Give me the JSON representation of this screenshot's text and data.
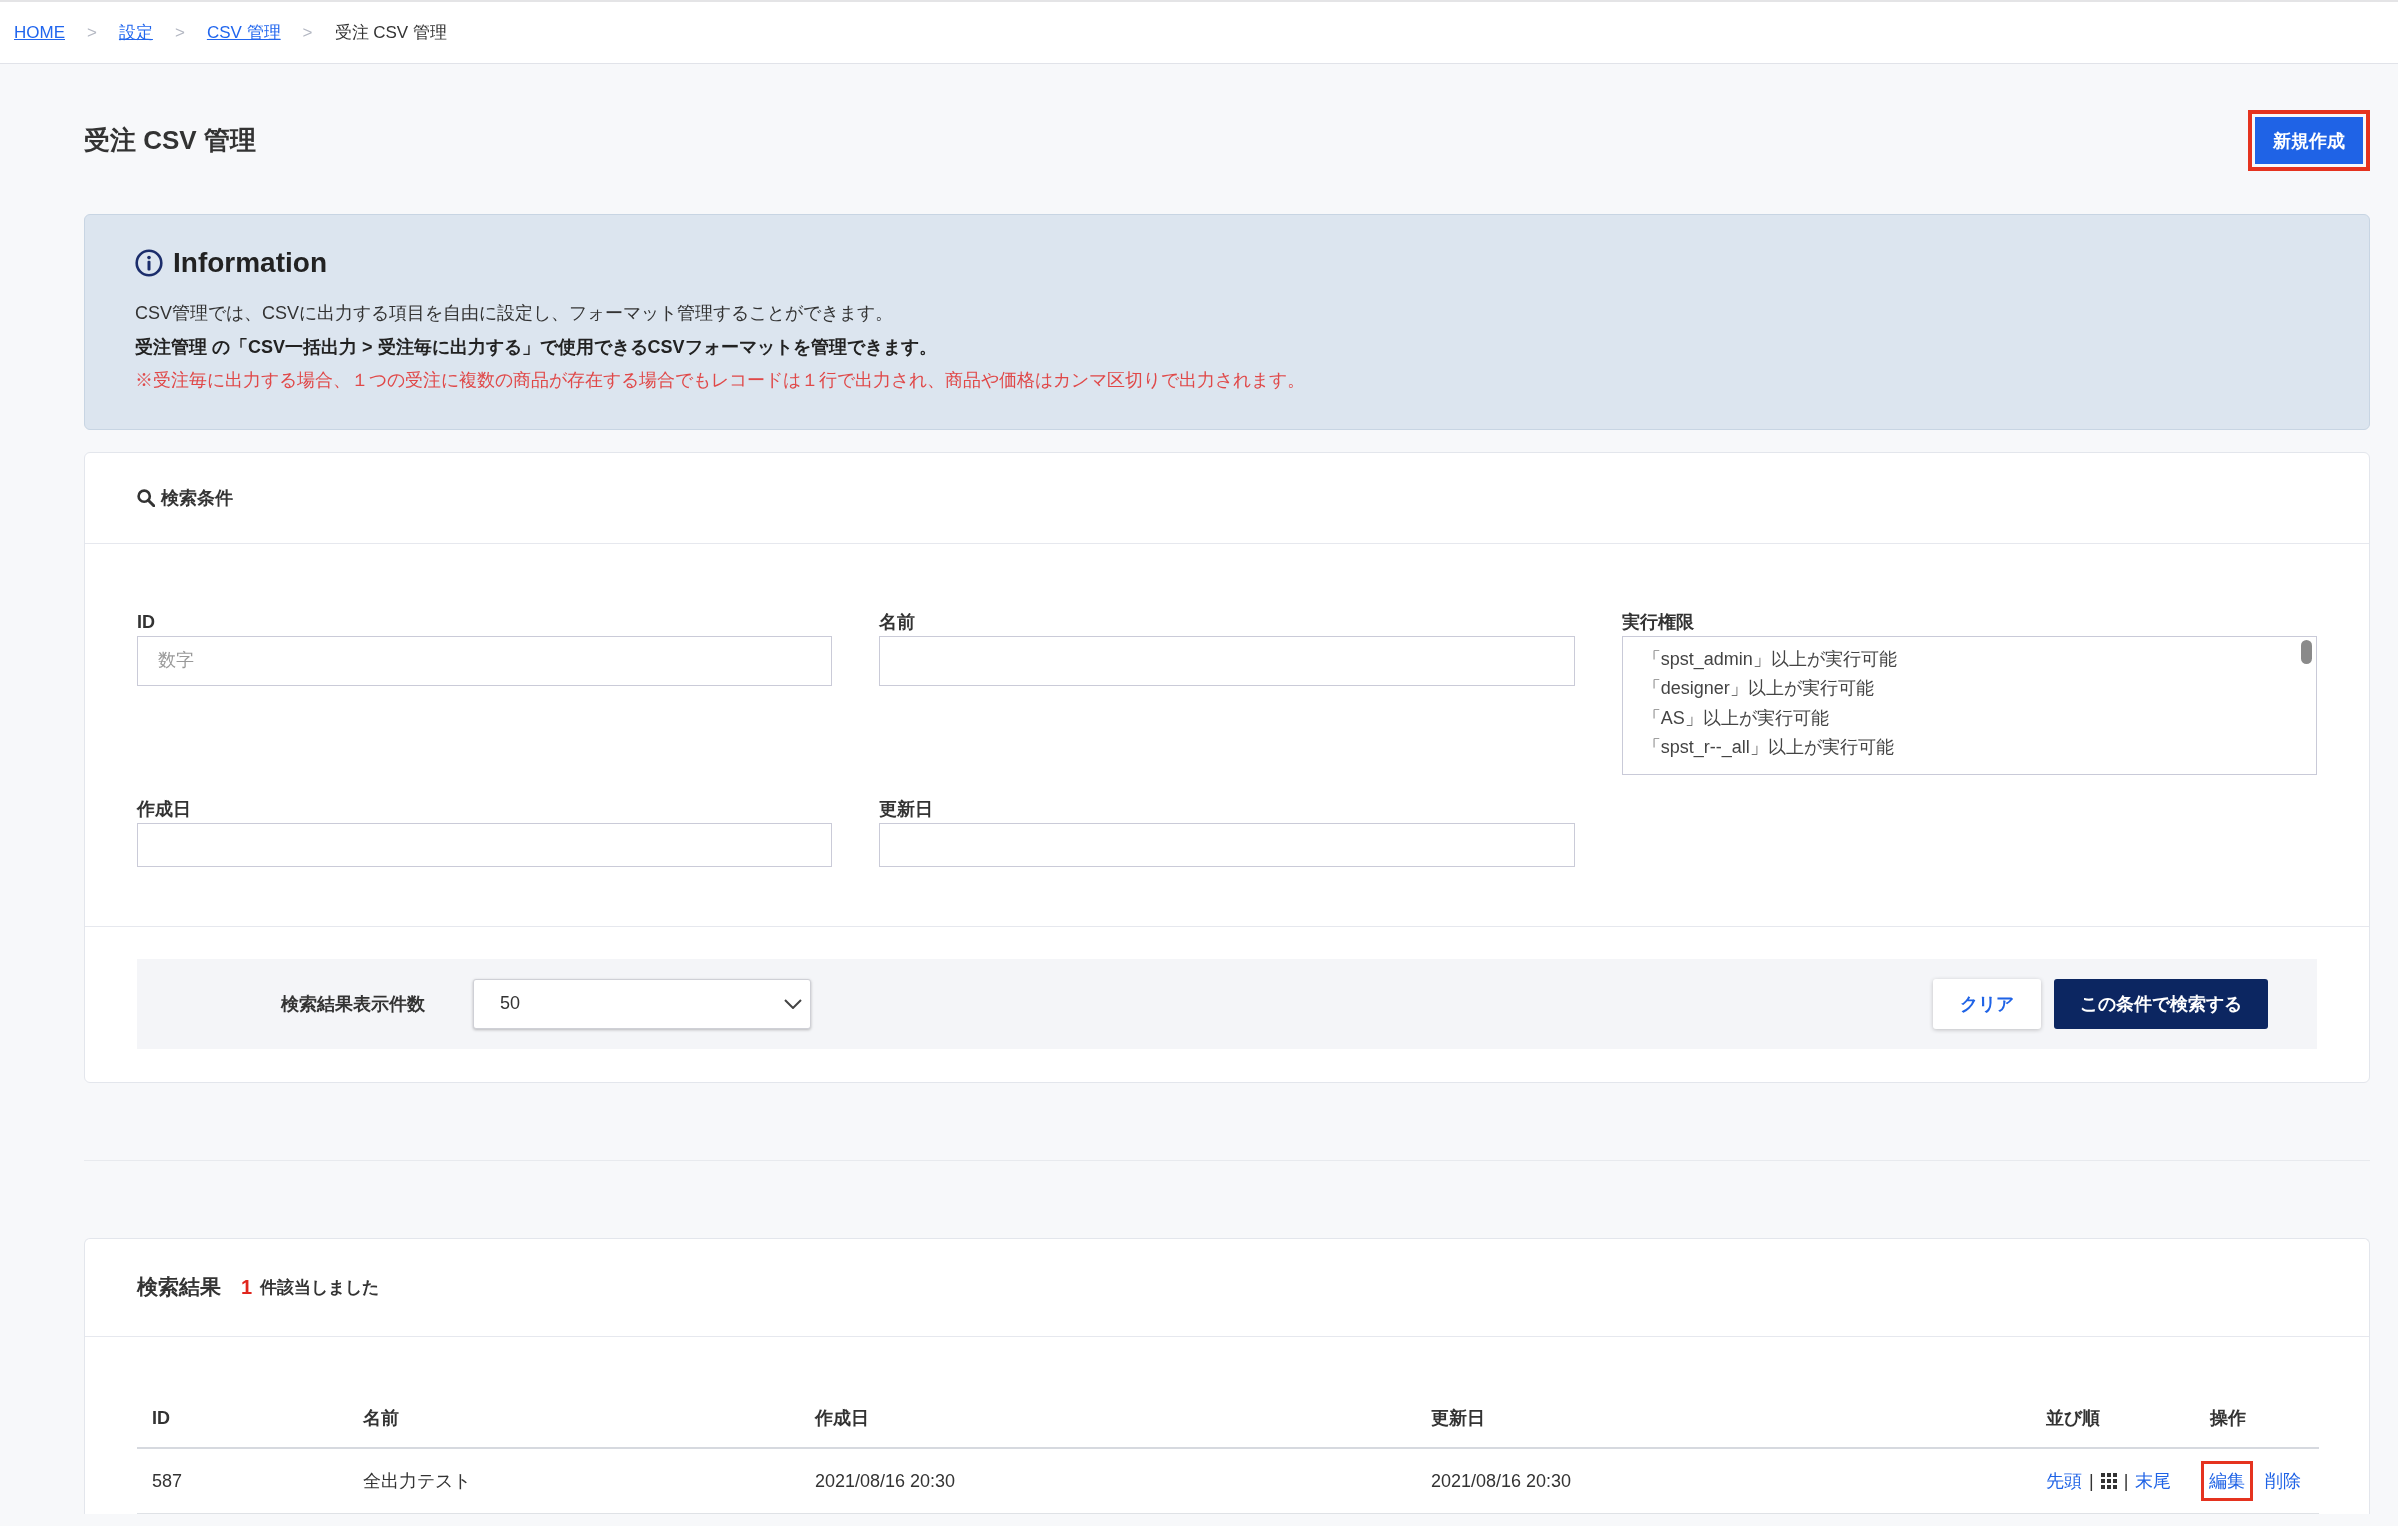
{
  "breadcrumb": [
    {
      "kind": "link",
      "label": "HOME"
    },
    {
      "kind": "separator",
      "label": ">"
    },
    {
      "kind": "link",
      "label": "設定"
    },
    {
      "kind": "separator",
      "label": ">"
    },
    {
      "kind": "link",
      "label": "CSV 管理"
    },
    {
      "kind": "separator",
      "label": ">"
    },
    {
      "kind": "current",
      "label": "受注 CSV 管理"
    }
  ],
  "page_title": "受注 CSV 管理",
  "new_button": {
    "label": "新規作成",
    "highlighted": true
  },
  "information": {
    "title": "Information",
    "lines": [
      {
        "kind": "plain",
        "text": "CSV管理では、CSVに出力する項目を自由に設定し、フォーマット管理することができます。"
      },
      {
        "kind": "bold",
        "text": "受注管理 の「CSV一括出力 > 受注毎に出力する」で使用できるCSVフォーマットを管理できます。"
      },
      {
        "kind": "warning",
        "text": "※受注毎に出力する場合、１つの受注に複数の商品が存在する場合でもレコードは１行で出力され、商品や価格はカンマ区切りで出力されます。"
      }
    ]
  },
  "search": {
    "title": "検索条件",
    "fields": [
      {
        "kind": "text",
        "label": "ID",
        "placeholder": "数字"
      },
      {
        "kind": "text",
        "label": "名前"
      },
      {
        "kind": "listbox",
        "label": "実行権限",
        "options": [
          "「spst_admin」以上が実行可能",
          "「designer」以上が実行可能",
          "「AS」以上が実行可能",
          "「spst_r--_all」以上が実行可能"
        ]
      },
      {
        "kind": "date",
        "label": "作成日"
      },
      {
        "kind": "date",
        "label": "更新日"
      }
    ],
    "page_size": {
      "label": "検索結果表示件数",
      "value": "50"
    },
    "buttons": [
      {
        "kind": "secondary",
        "label": "クリア"
      },
      {
        "kind": "primary",
        "label": "この条件で検索する"
      }
    ]
  },
  "results": {
    "title": "検索結果",
    "count": "1",
    "count_text": "件該当しました",
    "table": {
      "columns": [
        "ID",
        "名前",
        "作成日",
        "更新日",
        "並び順",
        "操作"
      ],
      "rows": [
        {
          "cells": [
            "587",
            "全出力テスト",
            "2021/08/16 20:30",
            "2021/08/16 20:30"
          ],
          "order": [
            {
              "kind": "link",
              "label": "先頭"
            },
            {
              "kind": "separator",
              "label": "|"
            },
            {
              "kind": "handle"
            },
            {
              "kind": "separator",
              "label": "|"
            },
            {
              "kind": "link",
              "label": "末尾"
            }
          ],
          "actions": [
            {
              "label": "編集",
              "highlighted": true
            },
            {
              "label": "削除",
              "highlighted": false
            }
          ]
        }
      ]
    }
  }
}
